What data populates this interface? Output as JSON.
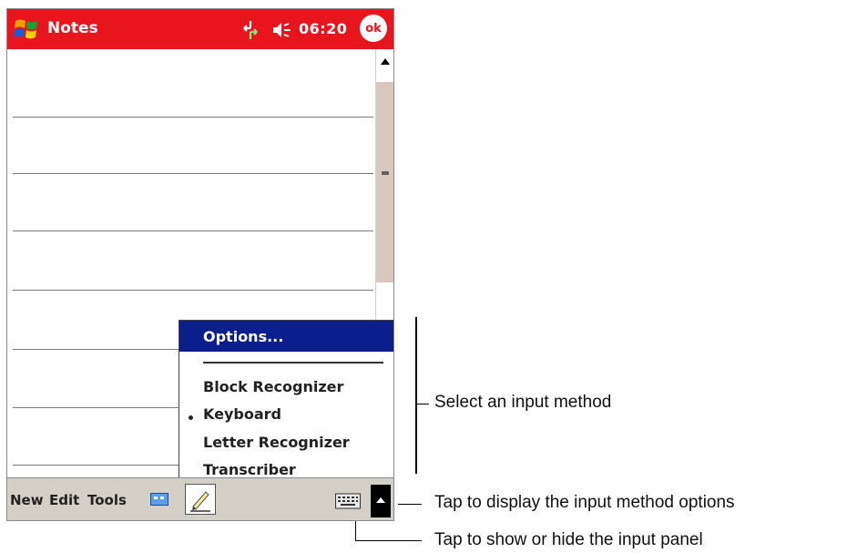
{
  "titlebar": {
    "app_title": "Notes",
    "clock": "06:20",
    "ok_label": "ok",
    "icons": [
      "windows-flag-icon",
      "connectivity-icon",
      "volume-icon"
    ]
  },
  "menu": {
    "options_label": "Options...",
    "items": [
      "Block Recognizer",
      "Keyboard",
      "Letter Recognizer",
      "Transcriber"
    ],
    "selected": "Keyboard"
  },
  "menubar": {
    "new": "New",
    "edit": "Edit",
    "tools": "Tools"
  },
  "callouts": {
    "select_method": "Select an input method",
    "display_options": "Tap to display the input method options",
    "show_hide_panel": "Tap to show or hide the input panel"
  },
  "colors": {
    "titlebar": "#e8141e",
    "menu_highlight": "#0b1f8c",
    "menubar": "#d4d0c8"
  }
}
